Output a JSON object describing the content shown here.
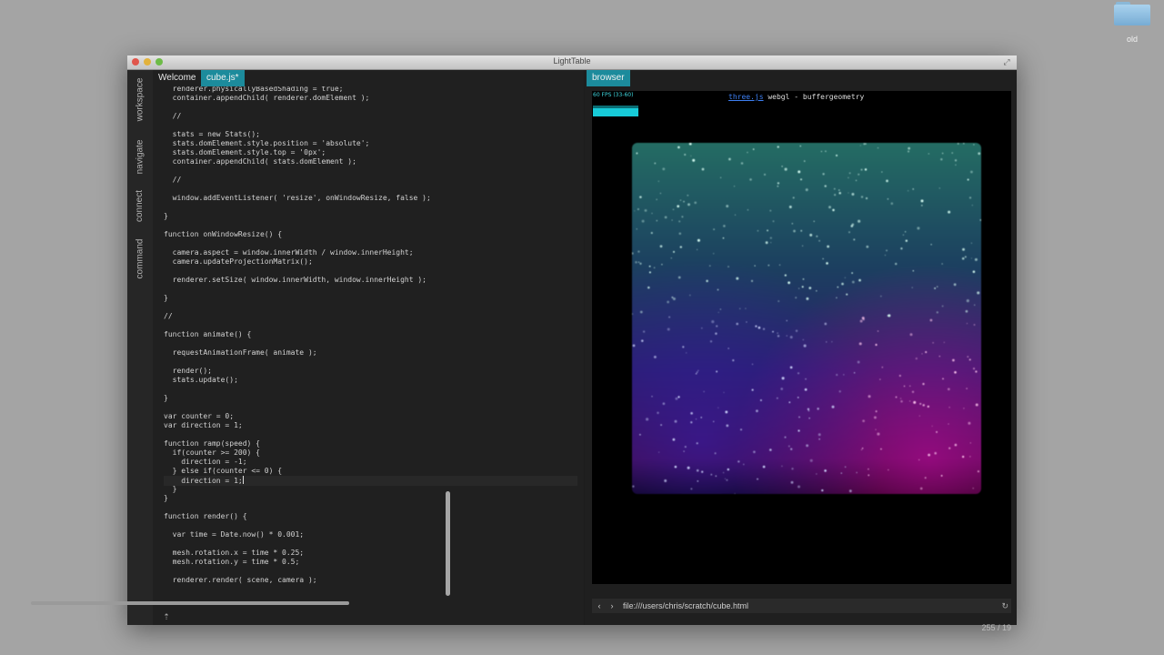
{
  "desktop": {
    "folder_label": "old"
  },
  "window": {
    "title": "LightTable"
  },
  "sidebar": {
    "items": [
      "workspace",
      "navigate",
      "connect",
      "command"
    ]
  },
  "editor": {
    "tabs": [
      "Welcome",
      "cube.js*"
    ],
    "code_lines": [
      "  renderer.physicallyBasedShading = true;",
      "  container.appendChild( renderer.domElement );",
      "  //",
      "  stats = new Stats();",
      "  stats.domElement.style.position = 'absolute';",
      "  stats.domElement.style.top = '0px';",
      "  container.appendChild( stats.domElement );",
      "  //",
      "  window.addEventListener( 'resize', onWindowResize, false );",
      "}",
      "function onWindowResize() {",
      "  camera.aspect = window.innerWidth / window.innerHeight;",
      "  camera.updateProjectionMatrix();",
      "  renderer.setSize( window.innerWidth, window.innerHeight );",
      "}",
      "//",
      "function animate() {",
      "  requestAnimationFrame( animate );",
      "  render();",
      "  stats.update();",
      "}",
      "var counter = 0;",
      "var direction = 1;",
      "function ramp(speed) {",
      "  if(counter >= 200) {",
      "    direction = -1;",
      "  } else if(counter <= 0) {",
      "    direction = 1;",
      "  }",
      "}",
      "function render() {",
      "  var time = Date.now() * 0.001;",
      "  mesh.rotation.x = time * 0.25;",
      "  mesh.rotation.y = time * 0.5;",
      "  renderer.render( scene, camera );"
    ]
  },
  "browser": {
    "tab": "browser",
    "fps_label": "60 FPS (33-60)",
    "caption_link": "three.js",
    "caption_text": " webgl - buffergeometry",
    "url": "file:///users/chris/scratch/cube.html",
    "status_position": "255 / 19"
  },
  "icons": {
    "back": "chevron-left-icon",
    "forward": "chevron-right-icon",
    "refresh": "refresh-icon",
    "scroll_top": "arrow-up-icon",
    "fullscreen": "fullscreen-icon"
  },
  "colors": {
    "accent": "#1c8b9c",
    "link": "#3d7ff3",
    "fps": "#17cbd8"
  }
}
